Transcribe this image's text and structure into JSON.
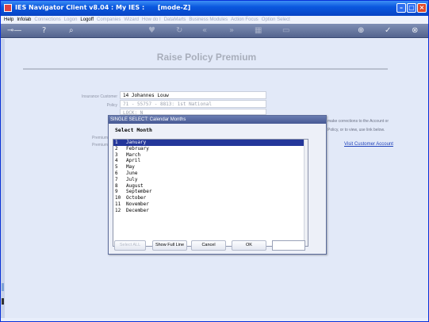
{
  "window": {
    "title": "IES Navigator Client v8.04 : My IES :      [mode-Z]"
  },
  "menu": {
    "items": [
      {
        "label": "Help",
        "dim": false
      },
      {
        "label": "Infolab",
        "dim": false
      },
      {
        "label": "Connections",
        "dim": true
      },
      {
        "label": "Logon",
        "dim": true
      },
      {
        "label": "Logoff",
        "dim": false
      },
      {
        "label": "Companies",
        "dim": true
      },
      {
        "label": "Wizard",
        "dim": true
      },
      {
        "label": "How do I",
        "dim": true
      },
      {
        "label": "DataMarts",
        "dim": true
      },
      {
        "label": "Business Modules",
        "dim": true
      },
      {
        "label": "Action Focus",
        "dim": true
      },
      {
        "label": "Option Select",
        "dim": true
      }
    ]
  },
  "page": {
    "title": "Raise Policy Premium",
    "fields": [
      {
        "label": "Insurance Customer",
        "value": "14 Johannes Louw"
      },
      {
        "label": "Policy",
        "value": "71 - 55757 - 8813: 1st National"
      },
      {
        "label": "",
        "value": "LOCK: N"
      }
    ],
    "hidden_labels": [
      "Premium",
      "Premium"
    ],
    "right_text_1": "make corrections to the Account or",
    "right_text_2": "Policy, or to view, use link below.",
    "visit_link": "Visit Customer Account"
  },
  "dialog": {
    "title": "SINGLE SELECT: Calendar Months",
    "heading": "Select Month",
    "months": [
      {
        "num": "1",
        "name": "January",
        "selected": true
      },
      {
        "num": "2",
        "name": "February",
        "selected": false
      },
      {
        "num": "3",
        "name": "March",
        "selected": false
      },
      {
        "num": "4",
        "name": "April",
        "selected": false
      },
      {
        "num": "5",
        "name": "May",
        "selected": false
      },
      {
        "num": "6",
        "name": "June",
        "selected": false
      },
      {
        "num": "7",
        "name": "July",
        "selected": false
      },
      {
        "num": "8",
        "name": "August",
        "selected": false
      },
      {
        "num": "9",
        "name": "September",
        "selected": false
      },
      {
        "num": "10",
        "name": "October",
        "selected": false
      },
      {
        "num": "11",
        "name": "November",
        "selected": false
      },
      {
        "num": "12",
        "name": "December",
        "selected": false
      }
    ],
    "buttons": {
      "select_all": "Select ALL",
      "show_full_line": "Show Full Line",
      "cancel": "Cancel",
      "ok": "OK"
    }
  },
  "colors": {
    "titlebar": "#0a58df",
    "selection": "#24379a",
    "link": "#2244bb"
  }
}
